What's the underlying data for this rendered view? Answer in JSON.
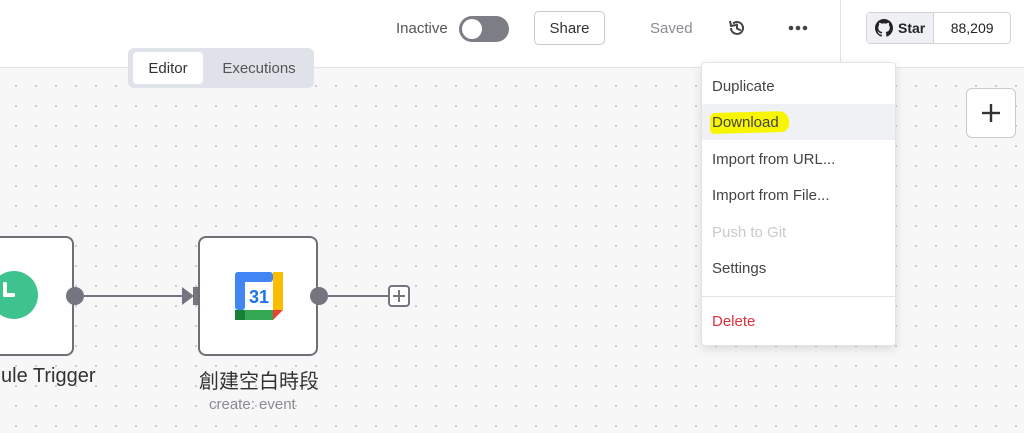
{
  "header": {
    "status_label": "Inactive",
    "share_label": "Share",
    "saved_label": "Saved",
    "github": {
      "star_label": "Star",
      "star_count": "88,209"
    }
  },
  "tabs": [
    {
      "label": "Editor",
      "active": true
    },
    {
      "label": "Executions",
      "active": false
    }
  ],
  "nodes": [
    {
      "title": "ule Trigger",
      "subtitle": ""
    },
    {
      "title": "創建空白時段",
      "subtitle": "create: event"
    }
  ],
  "calendar_icon_day": "31",
  "menu": {
    "items": [
      {
        "label": "Duplicate",
        "state": "normal"
      },
      {
        "label": "Download",
        "state": "highlighted"
      },
      {
        "label": "Import from URL...",
        "state": "normal"
      },
      {
        "label": "Import from File...",
        "state": "normal"
      },
      {
        "label": "Push to Git",
        "state": "disabled"
      },
      {
        "label": "Settings",
        "state": "normal"
      },
      {
        "label": "Delete",
        "state": "danger"
      }
    ]
  },
  "colors": {
    "highlight": "#f7f500",
    "trigger_green": "#3ec28e",
    "danger": "#e0303d"
  },
  "icons": [
    "history-icon",
    "more-icon",
    "github-icon",
    "plus-icon",
    "clock-icon",
    "google-calendar-icon"
  ]
}
